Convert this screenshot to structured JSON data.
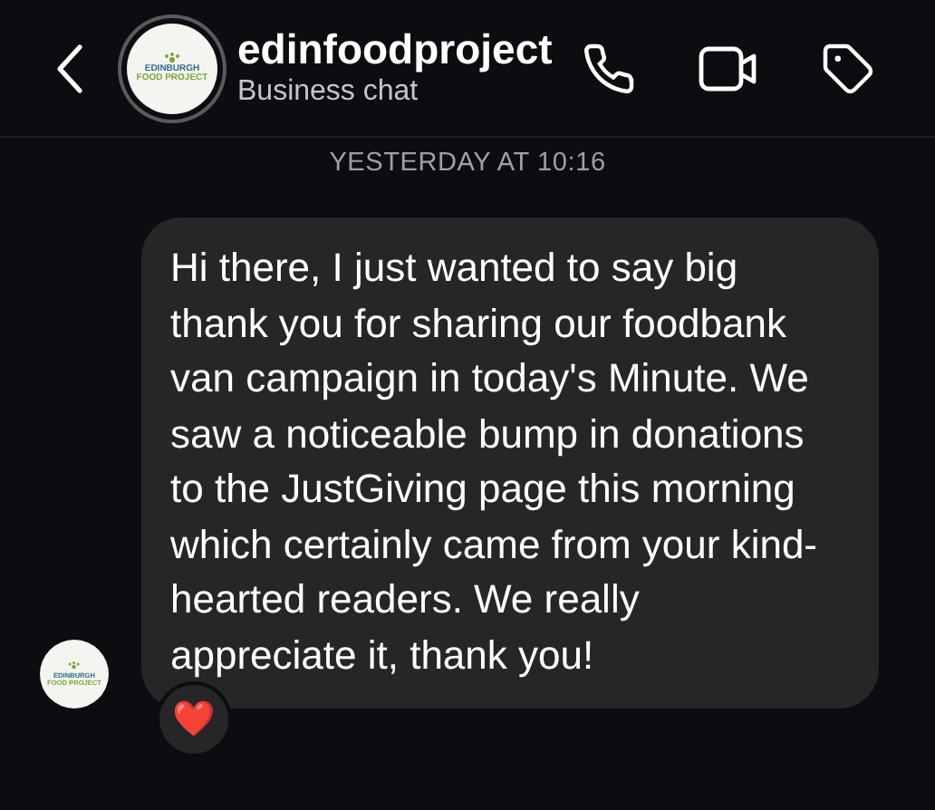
{
  "header": {
    "name": "edinfoodproject",
    "subtitle": "Business chat",
    "avatar_text": [
      "EDINBURGH",
      "FOOD PROJECT"
    ]
  },
  "timestamp": "YESTERDAY AT 10:16",
  "messages": [
    {
      "text": "Hi there, I just wanted to say big thank you for sharing our foodbank van campaign in today's Minute. We saw a noticeable bump in donations to the JustGiving page this morning which certainly came from your kind-hearted readers. We really appreciate it, thank you!",
      "avatar_text": [
        "EDINBURGH",
        "FOOD PROJECT"
      ],
      "reaction": "❤️"
    }
  ]
}
